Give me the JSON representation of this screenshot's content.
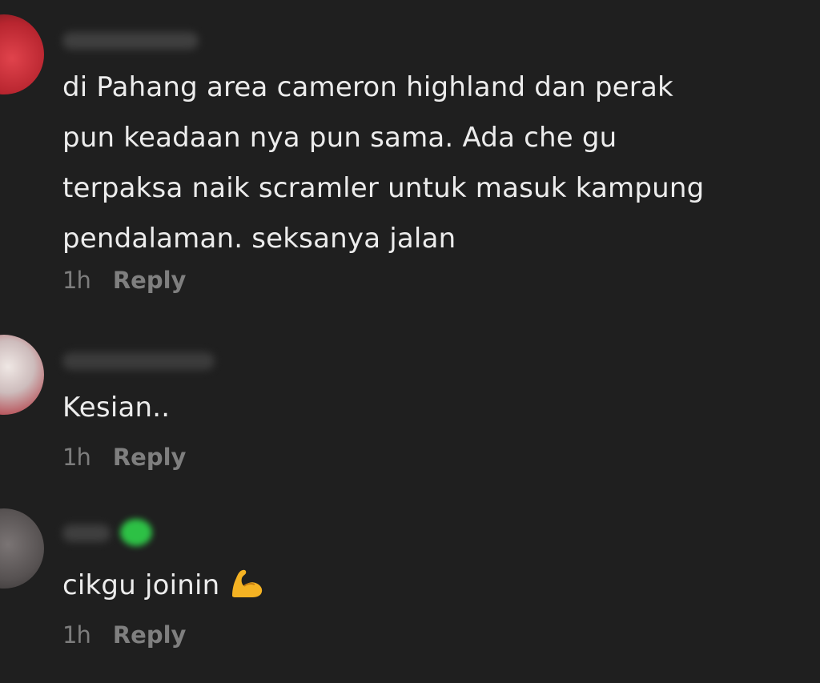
{
  "comments": [
    {
      "text": "di Pahang area cameron highland dan perak\npun keadaan nya pun sama. Ada che gu\nterpaksa naik scramler untuk masuk kampung\npendalaman. seksanya jalan",
      "time": "1h",
      "reply_label": "Reply",
      "avatar_color": "#d63a43"
    },
    {
      "text": "Kesian..",
      "time": "1h",
      "reply_label": "Reply",
      "avatar_color": "#c9bfbf"
    },
    {
      "text": "cikgu joinin",
      "emoji": "flexed-biceps-icon",
      "time": "1h",
      "reply_label": "Reply",
      "avatar_color": "#5a5656",
      "username_badge_color": "#2fd34a"
    }
  ],
  "colors": {
    "background": "#1f1f1f",
    "text": "#ececec",
    "meta": "#7d7d7d"
  }
}
